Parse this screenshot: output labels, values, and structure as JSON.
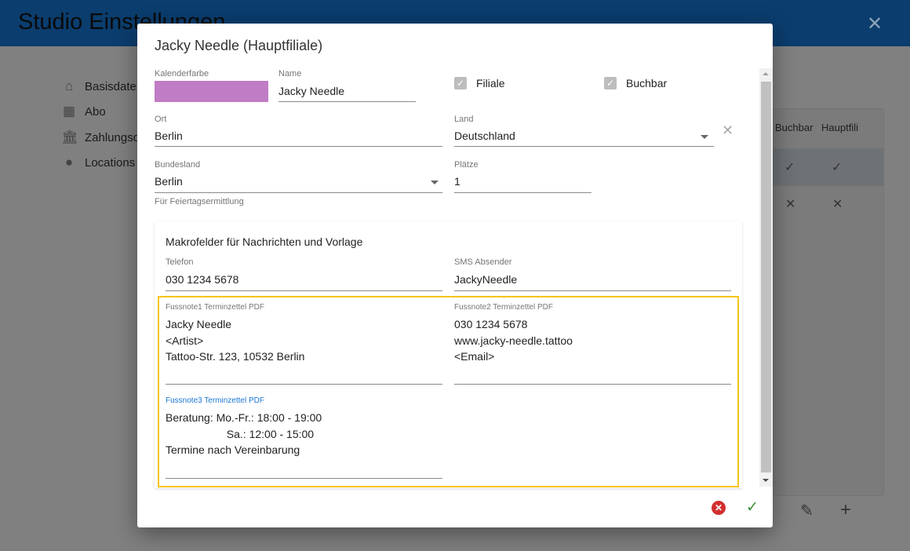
{
  "app": {
    "title": "Studio Einstellungen",
    "close_icon": "close-icon"
  },
  "sidebar": {
    "items": [
      {
        "label": "Basisdaten",
        "icon": "home-gear-icon"
      },
      {
        "label": "Abo",
        "icon": "calendar-dollar-icon"
      },
      {
        "label": "Zahlungsd",
        "icon": "bank-icon"
      },
      {
        "label": "Locations",
        "icon": "map-pin-icon"
      }
    ]
  },
  "table": {
    "headers": [
      "Buchbar",
      "Hauptfili"
    ],
    "rows": [
      [
        "✓",
        "✓"
      ],
      [
        "✕",
        "✕"
      ]
    ],
    "actions": [
      "edit-icon",
      "add-icon"
    ]
  },
  "dialog": {
    "title": "Jacky Needle (Hauptfiliale)",
    "kalenderfarbe": {
      "label": "Kalenderfarbe",
      "color": "#c07cc5"
    },
    "name": {
      "label": "Name",
      "value": "Jacky Needle"
    },
    "filiale": {
      "label": "Filiale",
      "checked": true
    },
    "buchbar": {
      "label": "Buchbar",
      "checked": true
    },
    "ort": {
      "label": "Ort",
      "value": "Berlin"
    },
    "land": {
      "label": "Land",
      "value": "Deutschland"
    },
    "bundesland": {
      "label": "Bundesland",
      "value": "Berlin",
      "hint": "Für Feiertagsermittlung"
    },
    "plaetze": {
      "label": "Plätze",
      "value": "1"
    },
    "makro": {
      "title": "Makrofelder für Nachrichten und Vorlage",
      "telefon": {
        "label": "Telefon",
        "value": "030 1234 5678"
      },
      "sms": {
        "label": "SMS Absender",
        "value": "JackyNeedle"
      },
      "fuss1": {
        "label": "Fussnote1 Terminzettel PDF",
        "value": "Jacky Needle\n<Artist>\nTattoo-Str. 123, 10532 Berlin"
      },
      "fuss2": {
        "label": "Fussnote2 Terminzettel PDF",
        "value": "030 1234 5678\nwww.jacky-needle.tattoo\n<Email>"
      },
      "fuss3": {
        "label": "Fussnote3 Terminzettel PDF",
        "value": "Beratung: Mo.-Fr.: 18:00 - 19:00\n                    Sa.: 12:00 - 15:00\nTermine nach Vereinbarung"
      }
    },
    "colors": {
      "highlight": "#f5c518",
      "focus_label": "#1976d2",
      "cancel": "#d32f2f",
      "confirm": "#388e3c"
    }
  }
}
